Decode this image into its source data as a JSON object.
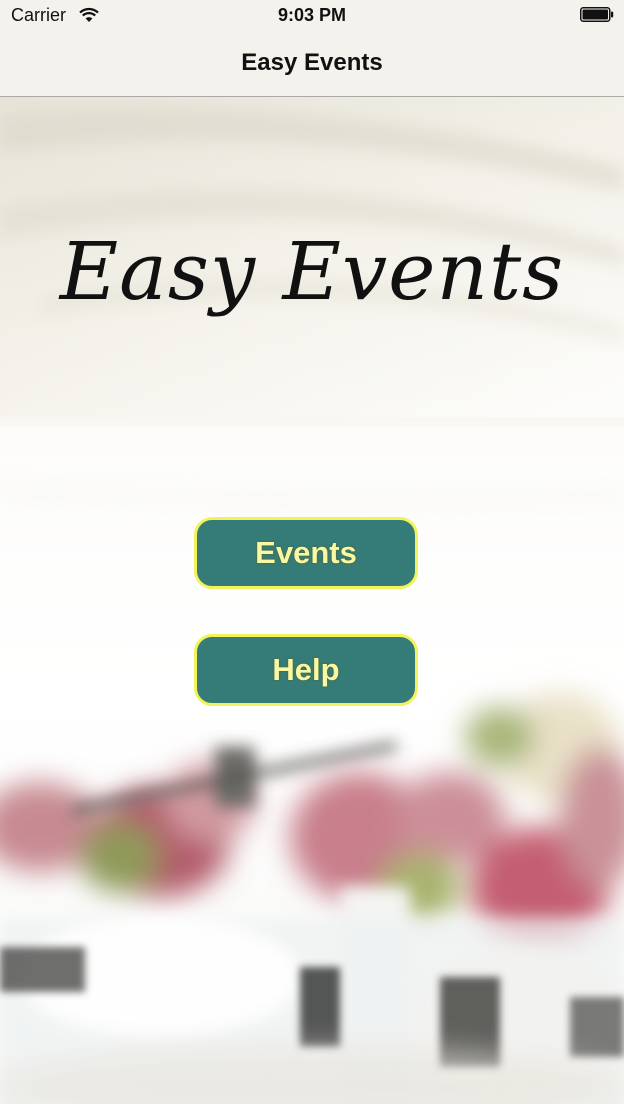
{
  "status_bar": {
    "carrier": "Carrier",
    "time": "9:03 PM",
    "wifi_icon": "wifi-icon",
    "battery_icon": "battery-icon"
  },
  "nav_bar": {
    "title": "Easy Events"
  },
  "hero": {
    "title": "Easy Events"
  },
  "buttons": {
    "events_label": "Events",
    "help_label": "Help"
  },
  "colors": {
    "button_fill": "#357c78",
    "button_border": "#f2f25a",
    "button_text": "#f8f7a4",
    "bar_background": "#f3f2ed"
  }
}
